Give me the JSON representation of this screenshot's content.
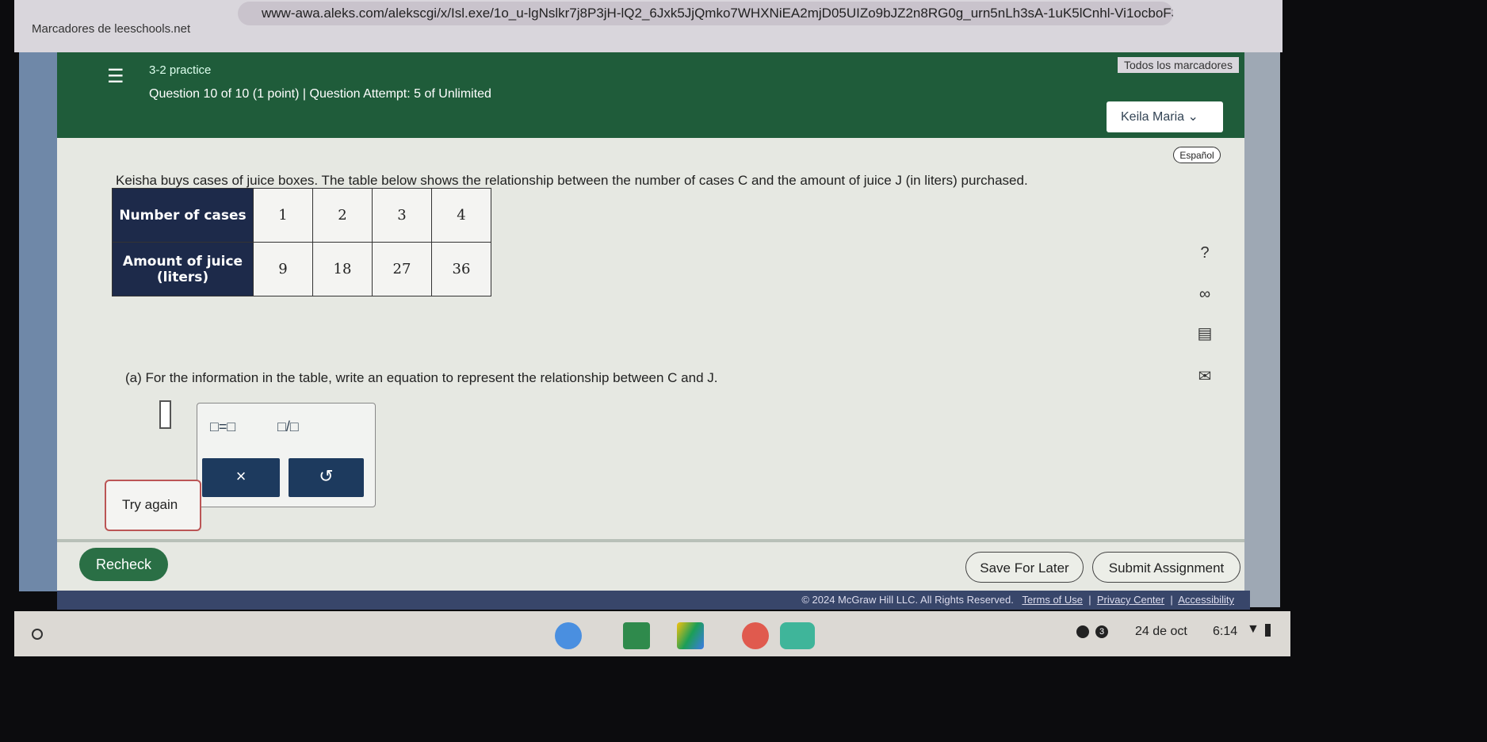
{
  "browser": {
    "url": "www-awa.aleks.com/alekscgi/x/Isl.exe/1o_u-lgNslkr7j8P3jH-lQ2_6Jxk5JjQmko7WHXNiEA2mjD05UIZo9bJZ2n8RG0g_urn5nLh3sA-1uK5lCnhl-Vi1ocboF38Us...",
    "bookmark": "Marcadores de leeschools.net",
    "all_bookmarks": "Todos los marcadores"
  },
  "header": {
    "course": "3-2 practice",
    "question": "Question 10 of 10 (1 point)  |  Question Attempt: 5 of Unlimited",
    "user": "Keila Maria"
  },
  "espanol": "Español",
  "problem": "Keisha buys cases of juice boxes. The table below shows the relationship between the number of cases C and the amount of juice J (in liters) purchased.",
  "table": {
    "row1_header": "Number of cases",
    "row1": [
      "1",
      "2",
      "3",
      "4"
    ],
    "row2_header": "Amount of juice (liters)",
    "row2": [
      "9",
      "18",
      "27",
      "36"
    ]
  },
  "side_icons": [
    "?",
    "∞",
    "▤",
    "✉"
  ],
  "part_a": "(a) For the information in the table, write an equation to represent the relationship between C and J.",
  "palette": {
    "equals": "□=□",
    "fraction": "□/□",
    "clear": "×",
    "undo": "↺"
  },
  "try_again": "Try again",
  "buttons": {
    "recheck": "Recheck",
    "save": "Save For Later",
    "submit": "Submit Assignment"
  },
  "footer": {
    "copyright": "© 2024 McGraw Hill LLC. All Rights Reserved.",
    "terms": "Terms of Use",
    "privacy": "Privacy Center",
    "accessibility": "Accessibility"
  },
  "taskbar": {
    "date": "24 de oct",
    "time": "6:14",
    "notifications": "3"
  }
}
